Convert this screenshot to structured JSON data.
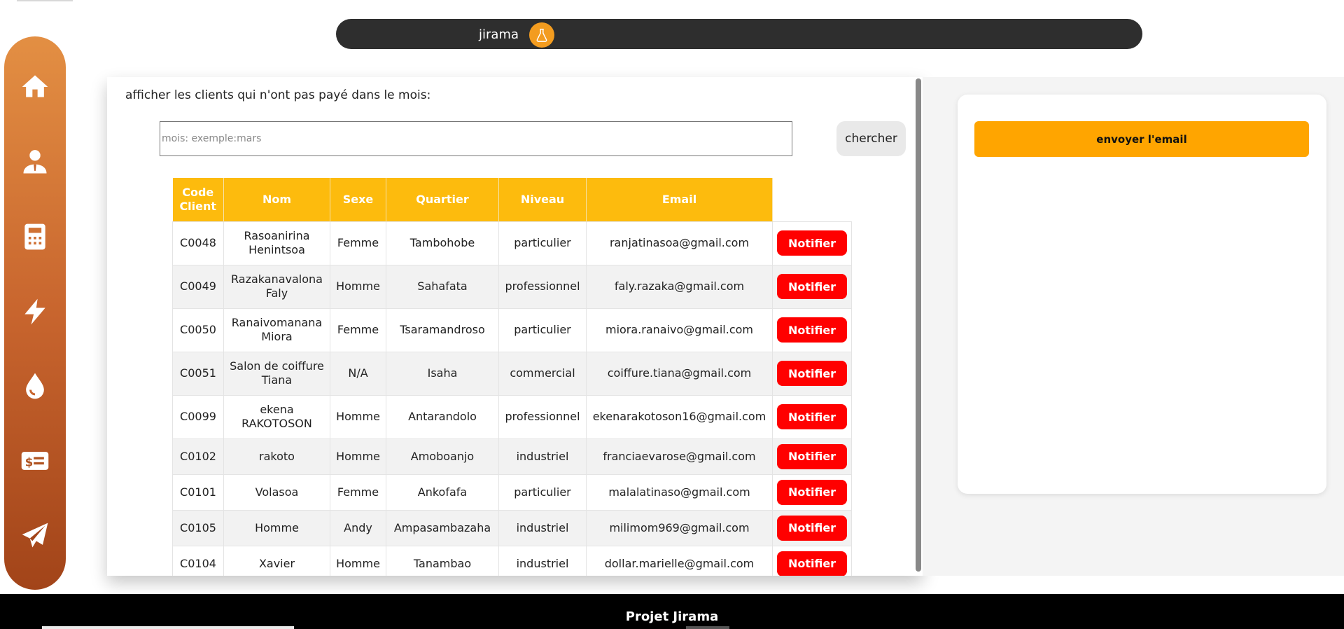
{
  "header": {
    "app_title": "jirama",
    "logo_icon": "flask-icon",
    "logo_color": "#f39c1f"
  },
  "sidebar": {
    "items": [
      {
        "icon": "home-icon"
      },
      {
        "icon": "user-icon"
      },
      {
        "icon": "calculator-icon"
      },
      {
        "icon": "bolt-icon"
      },
      {
        "icon": "water-drop-icon"
      },
      {
        "icon": "invoice-icon"
      },
      {
        "icon": "paper-plane-icon"
      }
    ],
    "gradient_top": "#e38f43",
    "gradient_bottom": "#a24419"
  },
  "filter": {
    "label": "afficher les clients qui n'ont pas payé dans le mois:",
    "input_placeholder": "mois: exemple:mars",
    "input_value": "",
    "search_label": "chercher"
  },
  "table": {
    "header_color": "#fdbb0d",
    "columns": [
      "Code Client",
      "Nom",
      "Sexe",
      "Quartier",
      "Niveau",
      "Email"
    ],
    "action_label": "Notifier",
    "action_color": "#ff0000",
    "rows": [
      {
        "code": "C0048",
        "nom": "Rasoanirina Henintsoa",
        "sexe": "Femme",
        "quartier": "Tambohobe",
        "niveau": "particulier",
        "email": "ranjatinasoa@gmail.com"
      },
      {
        "code": "C0049",
        "nom": "Razakanavalona Faly",
        "sexe": "Homme",
        "quartier": "Sahafata",
        "niveau": "professionnel",
        "email": "faly.razaka@gmail.com"
      },
      {
        "code": "C0050",
        "nom": "Ranaivomanana Miora",
        "sexe": "Femme",
        "quartier": "Tsaramandroso",
        "niveau": "particulier",
        "email": "miora.ranaivo@gmail.com"
      },
      {
        "code": "C0051",
        "nom": "Salon de coiffure Tiana",
        "sexe": "N/A",
        "quartier": "Isaha",
        "niveau": "commercial",
        "email": "coiffure.tiana@gmail.com"
      },
      {
        "code": "C0099",
        "nom": "ekena RAKOTOSON",
        "sexe": "Homme",
        "quartier": "Antarandolo",
        "niveau": "professionnel",
        "email": "ekenarakotoson16@gmail.com"
      },
      {
        "code": "C0102",
        "nom": "rakoto",
        "sexe": "Homme",
        "quartier": "Amoboanjo",
        "niveau": "industriel",
        "email": "franciaevarose@gmail.com"
      },
      {
        "code": "C0101",
        "nom": "Volasoa",
        "sexe": "Femme",
        "quartier": "Ankofafa",
        "niveau": "particulier",
        "email": "malalatinaso@gmail.com"
      },
      {
        "code": "C0105",
        "nom": "Homme",
        "sexe": "Andy",
        "quartier": "Ampasambazaha",
        "niveau": "industriel",
        "email": "milimom969@gmail.com"
      },
      {
        "code": "C0104",
        "nom": "Xavier",
        "sexe": "Homme",
        "quartier": "Tanambao",
        "niveau": "industriel",
        "email": "dollar.marielle@gmail.com"
      }
    ]
  },
  "email_panel": {
    "send_label": "envoyer l'email",
    "send_color": "#ffa500"
  },
  "footer": {
    "title": "Projet Jirama"
  }
}
